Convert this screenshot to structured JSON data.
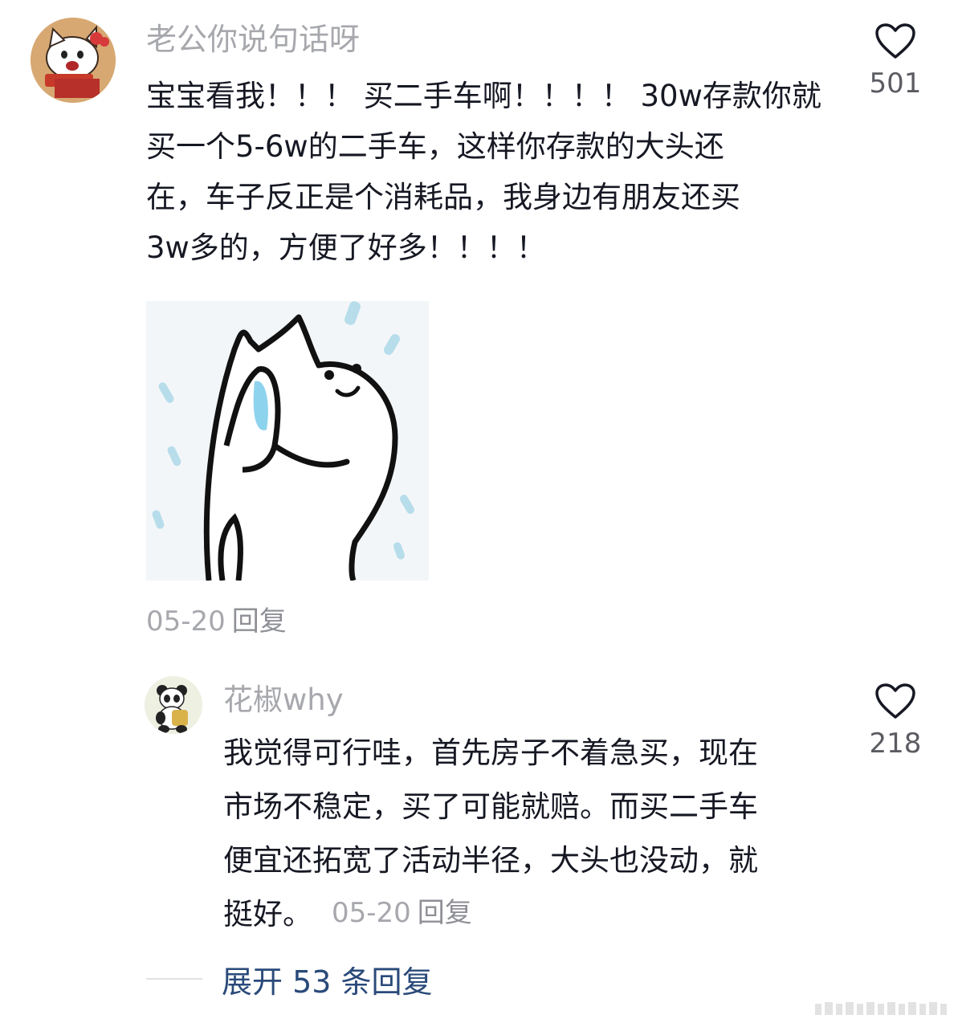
{
  "comments": [
    {
      "username": "老公你说句话呀",
      "text": "宝宝看我！！！ 买二手车啊！！！！ 30w存款你就\n买一个5-6w的二手车，这样你存款的大头还\n在，车子反正是个消耗品，我身边有朋友还买\n3w多的，方便了好多！！！！",
      "date": "05-20",
      "reply_label": "回复",
      "likes": "501"
    },
    {
      "username": "花椒why",
      "text": "我觉得可行哇，首先房子不着急买，现在\n市场不稳定，买了可能就赔。而买二手车\n便宜还拓宽了活动半径，大头也没动，就\n挺好。",
      "date": "05-20",
      "reply_label": "回复",
      "likes": "218"
    }
  ],
  "expand_replies": "展开 53 条回复",
  "icons": {
    "like": "heart-outline-icon",
    "avatar1": "hello-kitty-avatar",
    "avatar2": "panda-avatar",
    "sticker": "cat-wiping-tears-sticker"
  },
  "colors": {
    "username": "#a7a8ad",
    "text": "#161823",
    "likes": "#5b5c62",
    "expand": "#2a4a7a"
  }
}
